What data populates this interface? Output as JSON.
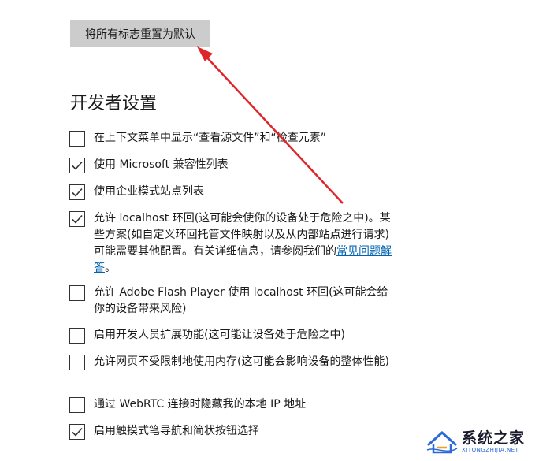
{
  "reset_button": {
    "label": "将所有标志重置为默认"
  },
  "section": {
    "title": "开发者设置"
  },
  "options": [
    {
      "label": "在上下文菜单中显示“查看源文件”和“检查元素”",
      "checked": false
    },
    {
      "label": "使用 Microsoft 兼容性列表",
      "checked": true
    },
    {
      "label": "使用企业模式站点列表",
      "checked": true
    },
    {
      "label_before_link": "允许 localhost 环回(这可能会使你的设备处于危险之中)。某些方案(如自定义环回托管文件映射以及从内部站点进行请求)可能需要其他配置。有关详细信息，请参阅我们的",
      "link_text": "常见问题解答",
      "label_after_link": "。",
      "checked": true
    },
    {
      "label": "允许 Adobe Flash Player 使用 localhost 环回(这可能会给你的设备带来风险)",
      "checked": false
    },
    {
      "label": "启用开发人员扩展功能(这可能让设备处于危险之中)",
      "checked": false
    },
    {
      "label": "允许网页不受限制地使用内存(这可能会影响设备的整体性能)",
      "checked": false
    },
    {
      "label": "通过 WebRTC 连接时隐藏我的本地 IP 地址",
      "checked": false
    },
    {
      "label": "启用触摸式笔导航和简状按钮选择",
      "checked": true
    }
  ],
  "watermark": {
    "main_text": "系统之家",
    "sub_text": "XITONGZHIJIA.NET",
    "icon": "house-logo-icon"
  },
  "annotation": {
    "arrow_color": "#e0242b",
    "icon": "red-arrow-icon"
  },
  "colors": {
    "button_bg": "#cccccc",
    "link": "#0063b1",
    "text": "#1a1a1a"
  }
}
